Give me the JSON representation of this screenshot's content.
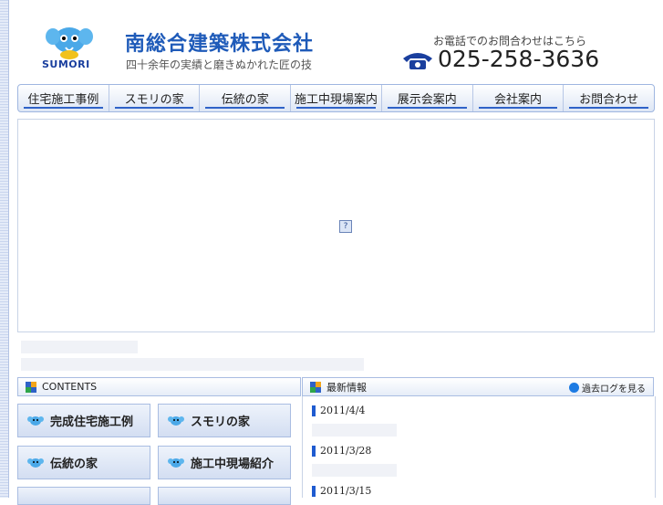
{
  "header": {
    "logo_text": "SUMORI",
    "company_name": "南総合建築株式会社",
    "tagline": "四十余年の実績と磨きぬかれた匠の技",
    "phone_caption": "お電話でのお問合わせはこちら",
    "phone_number": "025-258-3636"
  },
  "nav": {
    "items": [
      {
        "label": "住宅施工事例"
      },
      {
        "label": "スモリの家"
      },
      {
        "label": "伝統の家"
      },
      {
        "label": "施工中現場案内"
      },
      {
        "label": "展示会案内"
      },
      {
        "label": "会社案内"
      },
      {
        "label": "お問合わせ"
      }
    ]
  },
  "hero": {
    "broken_icon_glyph": "?"
  },
  "contents": {
    "title": "CONTENTS",
    "buttons": [
      {
        "label": "完成住宅施工例"
      },
      {
        "label": "スモリの家"
      },
      {
        "label": "伝統の家"
      },
      {
        "label": "施工中現場紹介"
      },
      {
        "label": ""
      },
      {
        "label": ""
      }
    ]
  },
  "news": {
    "title": "最新情報",
    "past_log": "過去ログを見る",
    "items": [
      {
        "date": "2011/4/4"
      },
      {
        "date": "2011/3/28"
      },
      {
        "date": "2011/3/15"
      }
    ]
  },
  "colors": {
    "brand_blue": "#1f5bb9",
    "nav_underline": "#2e62c8",
    "bullet_blue": "#1f5bd0"
  }
}
